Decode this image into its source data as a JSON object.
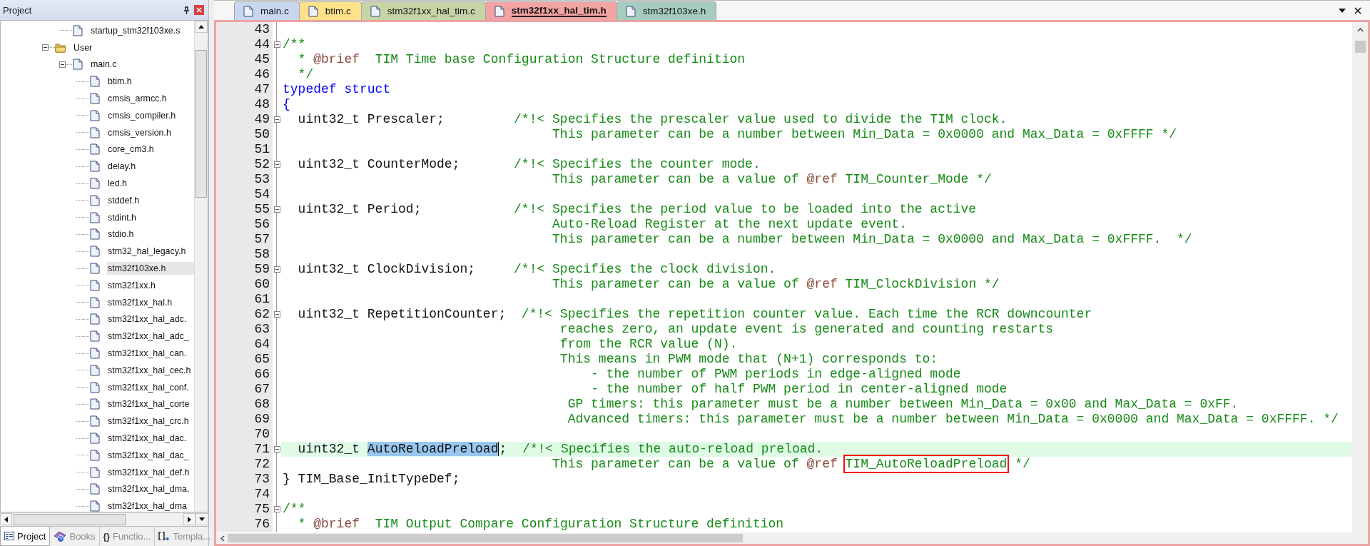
{
  "project_panel": {
    "title": "Project",
    "tree": [
      {
        "kind": "group",
        "children": [
          {
            "kind": "file",
            "label": "startup_stm32f103xe.s",
            "selected": false
          }
        ]
      },
      {
        "kind": "folder",
        "label": "User",
        "expanded": true,
        "selected": false,
        "children": [
          {
            "kind": "file",
            "label": "main.c",
            "expanded": true,
            "selected": false,
            "children": [
              {
                "kind": "file",
                "label": "btim.h",
                "selected": false
              },
              {
                "kind": "file",
                "label": "cmsis_armcc.h",
                "selected": false
              },
              {
                "kind": "file",
                "label": "cmsis_compiler.h",
                "selected": false
              },
              {
                "kind": "file",
                "label": "cmsis_version.h",
                "selected": false
              },
              {
                "kind": "file",
                "label": "core_cm3.h",
                "selected": false
              },
              {
                "kind": "file",
                "label": "delay.h",
                "selected": false
              },
              {
                "kind": "file",
                "label": "led.h",
                "selected": false
              },
              {
                "kind": "file",
                "label": "stddef.h",
                "selected": false
              },
              {
                "kind": "file",
                "label": "stdint.h",
                "selected": false
              },
              {
                "kind": "file",
                "label": "stdio.h",
                "selected": false
              },
              {
                "kind": "file",
                "label": "stm32_hal_legacy.h",
                "selected": false
              },
              {
                "kind": "file",
                "label": "stm32f103xe.h",
                "selected": true
              },
              {
                "kind": "file",
                "label": "stm32f1xx.h",
                "selected": false
              },
              {
                "kind": "file",
                "label": "stm32f1xx_hal.h",
                "selected": false
              },
              {
                "kind": "file",
                "label": "stm32f1xx_hal_adc.",
                "selected": false
              },
              {
                "kind": "file",
                "label": "stm32f1xx_hal_adc_",
                "selected": false
              },
              {
                "kind": "file",
                "label": "stm32f1xx_hal_can.",
                "selected": false
              },
              {
                "kind": "file",
                "label": "stm32f1xx_hal_cec.h",
                "selected": false
              },
              {
                "kind": "file",
                "label": "stm32f1xx_hal_conf.",
                "selected": false
              },
              {
                "kind": "file",
                "label": "stm32f1xx_hal_corte",
                "selected": false
              },
              {
                "kind": "file",
                "label": "stm32f1xx_hal_crc.h",
                "selected": false
              },
              {
                "kind": "file",
                "label": "stm32f1xx_hal_dac.",
                "selected": false
              },
              {
                "kind": "file",
                "label": "stm32f1xx_hal_dac_",
                "selected": false
              },
              {
                "kind": "file",
                "label": "stm32f1xx_hal_def.h",
                "selected": false
              },
              {
                "kind": "file",
                "label": "stm32f1xx_hal_dma.",
                "selected": false
              },
              {
                "kind": "file",
                "label": "stm32f1xx_hal_dma",
                "selected": false
              }
            ]
          }
        ]
      }
    ],
    "bottom_tabs": [
      {
        "kind": "project",
        "label": "Project",
        "selected": true
      },
      {
        "kind": "books",
        "label": "Books",
        "selected": false
      },
      {
        "kind": "functions",
        "glyph": "{}",
        "label": "Functio...",
        "selected": false
      },
      {
        "kind": "templates",
        "label": "Templa...",
        "selected": false
      }
    ]
  },
  "editor": {
    "tabs": [
      {
        "label": "main.c",
        "color": "#c9d6f0",
        "selected": false
      },
      {
        "label": "btim.c",
        "color": "#fde28a",
        "selected": false
      },
      {
        "label": "stm32f1xx_hal_tim.c",
        "color": "#c6d4a6",
        "selected": false
      },
      {
        "label": "stm32f1xx_hal_tim.h",
        "color": "#f2a3a3",
        "selected": true
      },
      {
        "label": "stm32f103xe.h",
        "color": "#a6cbbf",
        "selected": false
      }
    ],
    "lines": [
      {
        "n": "43",
        "fold": false,
        "current": false
      },
      {
        "n": "44",
        "fold": true,
        "current": false,
        "tokens": [
          {
            "kind": "comment",
            "text": "/**"
          }
        ]
      },
      {
        "n": "45",
        "fold": false,
        "current": false,
        "tokens": [
          {
            "kind": "comment",
            "text": "  * "
          },
          {
            "kind": "doc",
            "text": "@brief"
          },
          {
            "kind": "comment",
            "text": "  TIM Time base Configuration Structure definition"
          }
        ]
      },
      {
        "n": "46",
        "fold": false,
        "current": false,
        "tokens": [
          {
            "kind": "comment",
            "text": "  */"
          }
        ]
      },
      {
        "n": "47",
        "fold": false,
        "current": false,
        "tokens": [
          {
            "kind": "keyword",
            "text": "typedef struct"
          }
        ]
      },
      {
        "n": "48",
        "fold": false,
        "current": false,
        "tokens": [
          {
            "kind": "keyword",
            "text": "{"
          }
        ]
      },
      {
        "n": "49",
        "fold": true,
        "current": false,
        "tokens": [
          {
            "kind": "code",
            "text": "  uint32_t Prescaler;         "
          },
          {
            "kind": "comment",
            "text": "/*!< Specifies the prescaler value used to divide the TIM clock."
          }
        ]
      },
      {
        "n": "50",
        "fold": false,
        "current": false,
        "tokens": [
          {
            "kind": "comment",
            "text": "                                   This parameter can be a number between Min_Data = 0x0000 and Max_Data = 0xFFFF */"
          }
        ]
      },
      {
        "n": "51",
        "fold": false,
        "current": false
      },
      {
        "n": "52",
        "fold": true,
        "current": false,
        "tokens": [
          {
            "kind": "code",
            "text": "  uint32_t CounterMode;       "
          },
          {
            "kind": "comment",
            "text": "/*!< Specifies the counter mode."
          }
        ]
      },
      {
        "n": "53",
        "fold": false,
        "current": false,
        "tokens": [
          {
            "kind": "comment",
            "text": "                                   This parameter can be a value of "
          },
          {
            "kind": "doc",
            "text": "@ref"
          },
          {
            "kind": "comment",
            "text": " TIM_Counter_Mode */"
          }
        ]
      },
      {
        "n": "54",
        "fold": false,
        "current": false
      },
      {
        "n": "55",
        "fold": true,
        "current": false,
        "tokens": [
          {
            "kind": "code",
            "text": "  uint32_t Period;            "
          },
          {
            "kind": "comment",
            "text": "/*!< Specifies the period value to be loaded into the active"
          }
        ]
      },
      {
        "n": "56",
        "fold": false,
        "current": false,
        "tokens": [
          {
            "kind": "comment",
            "text": "                                   Auto-Reload Register at the next update event."
          }
        ]
      },
      {
        "n": "57",
        "fold": false,
        "current": false,
        "tokens": [
          {
            "kind": "comment",
            "text": "                                   This parameter can be a number between Min_Data = 0x0000 and Max_Data = 0xFFFF.  */"
          }
        ]
      },
      {
        "n": "58",
        "fold": false,
        "current": false
      },
      {
        "n": "59",
        "fold": true,
        "current": false,
        "tokens": [
          {
            "kind": "code",
            "text": "  uint32_t ClockDivision;     "
          },
          {
            "kind": "comment",
            "text": "/*!< Specifies the clock division."
          }
        ]
      },
      {
        "n": "60",
        "fold": false,
        "current": false,
        "tokens": [
          {
            "kind": "comment",
            "text": "                                   This parameter can be a value of "
          },
          {
            "kind": "doc",
            "text": "@ref"
          },
          {
            "kind": "comment",
            "text": " TIM_ClockDivision */"
          }
        ]
      },
      {
        "n": "61",
        "fold": false,
        "current": false
      },
      {
        "n": "62",
        "fold": true,
        "current": false,
        "tokens": [
          {
            "kind": "code",
            "text": "  uint32_t RepetitionCounter;  "
          },
          {
            "kind": "comment",
            "text": "/*!< Specifies the repetition counter value. Each time the RCR downcounter"
          }
        ]
      },
      {
        "n": "63",
        "fold": false,
        "current": false,
        "tokens": [
          {
            "kind": "comment",
            "text": "                                    reaches zero, an update event is generated and counting restarts"
          }
        ]
      },
      {
        "n": "64",
        "fold": false,
        "current": false,
        "tokens": [
          {
            "kind": "comment",
            "text": "                                    from the RCR value (N)."
          }
        ]
      },
      {
        "n": "65",
        "fold": false,
        "current": false,
        "tokens": [
          {
            "kind": "comment",
            "text": "                                    This means in PWM mode that (N+1) corresponds to:"
          }
        ]
      },
      {
        "n": "66",
        "fold": false,
        "current": false,
        "tokens": [
          {
            "kind": "comment",
            "text": "                                        - the number of PWM periods in edge-aligned mode"
          }
        ]
      },
      {
        "n": "67",
        "fold": false,
        "current": false,
        "tokens": [
          {
            "kind": "comment",
            "text": "                                        - the number of half PWM period in center-aligned mode"
          }
        ]
      },
      {
        "n": "68",
        "fold": false,
        "current": false,
        "tokens": [
          {
            "kind": "comment",
            "text": "                                     GP timers: this parameter must be a number between Min_Data = 0x00 and Max_Data = 0xFF."
          }
        ]
      },
      {
        "n": "69",
        "fold": false,
        "current": false,
        "tokens": [
          {
            "kind": "comment",
            "text": "                                     Advanced timers: this parameter must be a number between Min_Data = 0x0000 and Max_Data = 0xFFFF. */"
          }
        ]
      },
      {
        "n": "70",
        "fold": false,
        "current": false
      },
      {
        "n": "71",
        "fold": true,
        "current": true,
        "tokens": [
          {
            "kind": "code",
            "text": "  uint32_t "
          },
          {
            "kind": "selection",
            "text": "AutoReloadPreload"
          },
          {
            "kind": "code",
            "text": ";  "
          },
          {
            "kind": "comment",
            "text": "/*!< Specifies the auto-reload preload."
          }
        ]
      },
      {
        "n": "72",
        "fold": false,
        "current": false,
        "tokens": [
          {
            "kind": "comment",
            "text": "                                   This parameter can be a value of "
          },
          {
            "kind": "doc",
            "text": "@ref "
          },
          {
            "kind": "boxed",
            "text": "TIM_AutoReloadPreload"
          },
          {
            "kind": "comment",
            "text": " */"
          }
        ]
      },
      {
        "n": "73",
        "fold": false,
        "current": false,
        "tokens": [
          {
            "kind": "code",
            "text": "} TIM_Base_InitTypeDef;"
          }
        ]
      },
      {
        "n": "74",
        "fold": false,
        "current": false
      },
      {
        "n": "75",
        "fold": true,
        "current": false,
        "tokens": [
          {
            "kind": "comment",
            "text": "/**"
          }
        ]
      },
      {
        "n": "76",
        "fold": false,
        "current": false,
        "tokens": [
          {
            "kind": "comment",
            "text": "  * "
          },
          {
            "kind": "doc",
            "text": "@brief"
          },
          {
            "kind": "comment",
            "text": "  TIM Output Compare Configuration Structure definition"
          }
        ]
      }
    ]
  }
}
